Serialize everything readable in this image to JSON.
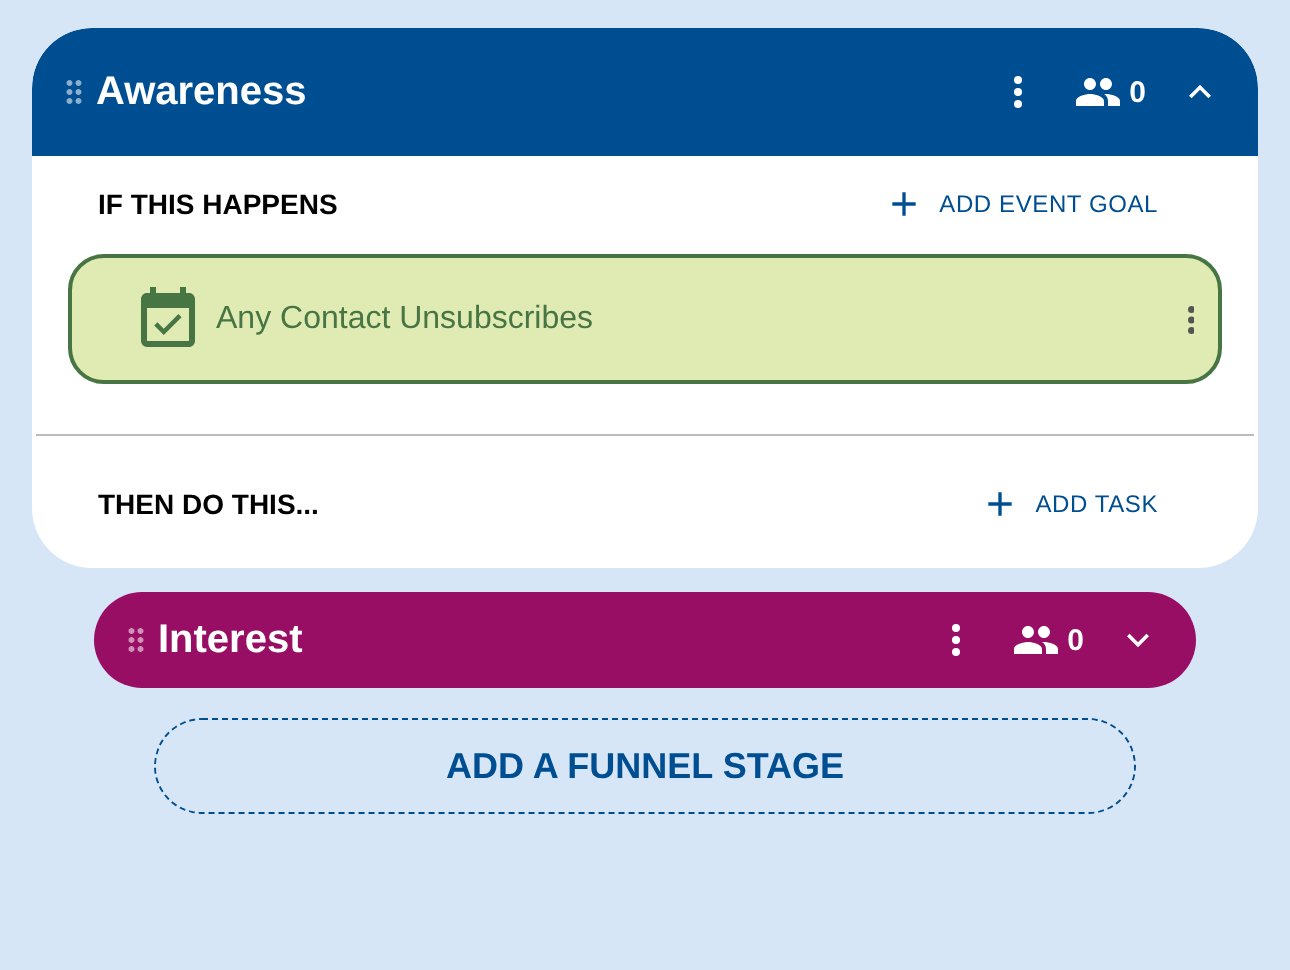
{
  "stages": [
    {
      "title": "Awareness",
      "color": "#004e92",
      "count": "0",
      "expanded": true,
      "sections": [
        {
          "heading": "IF THIS HAPPENS",
          "action": "ADD EVENT GOAL",
          "items": [
            {
              "label": "Any Contact Unsubscribes"
            }
          ]
        },
        {
          "heading": "THEN DO THIS...",
          "action": "ADD TASK"
        }
      ]
    },
    {
      "title": "Interest",
      "color": "#970e64",
      "count": "0",
      "expanded": false
    }
  ],
  "add_stage": "ADD A FUNNEL STAGE"
}
